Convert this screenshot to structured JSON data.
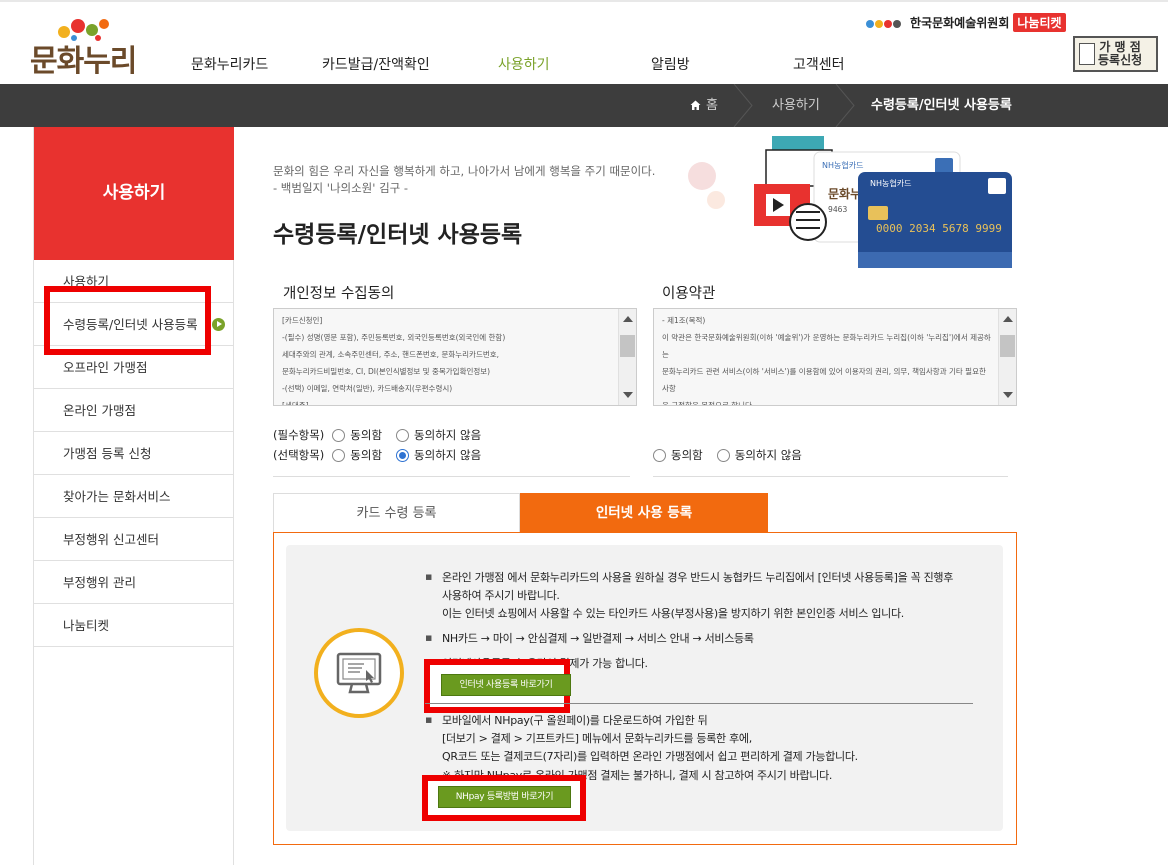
{
  "header": {
    "logo_text": "문화누리",
    "nav": [
      "문화누리카드",
      "카드발급/잔액확인",
      "사용하기",
      "알림방",
      "고객센터"
    ],
    "nav_active_index": 2,
    "org_name": "한국문화예술위원회",
    "ticket_label": "나눔티켓",
    "merchant_button": [
      "가 맹 점",
      "등록신청"
    ]
  },
  "breadcrumb": {
    "home": "홈",
    "level1": "사용하기",
    "current": "수령등록/인터넷 사용등록"
  },
  "sidebar": {
    "title": "사용하기",
    "items": [
      "사용하기",
      "수령등록/인터넷 사용등록",
      "오프라인 가맹점",
      "온라인 가맹점",
      "가맹점 등록 신청",
      "찾아가는 문화서비스",
      "부정행위 신고센터",
      "부정행위 관리",
      "나눔티켓"
    ],
    "active_index": 1
  },
  "main": {
    "quote_line1": "문화의 힘은 우리 자신을 행복하게 하고, 나아가서 남에게 행복을 주기 때문이다.",
    "quote_line2": "- 백범일지 '나의소원' 김구 -",
    "title": "수령등록/인터넷 사용등록",
    "card_illustration": {
      "card_brand": "NH농협카드",
      "card_number": "0000 2034 5678 9999",
      "logo_text": "문화누리"
    }
  },
  "privacy": {
    "title": "개인정보 수집동의",
    "lines": [
      "[카드신청인]",
      "-(필수) 성명(영문 포함), 주민등록번호, 외국인등록번호(외국인에 한함)",
      "세대주와의 관계, 소속주민센터, 주소, 핸드폰번호, 문화누리카드번호,",
      "문화누리카드비밀번호, CI, DI(본인식별정보 및 중복가입확인정보)",
      "-(선택) 이메일, 연락처(일반), 카드배송지(우편수령시)",
      "[세대주]"
    ],
    "required_label": "(필수항목)",
    "optional_label": "(선택항목)",
    "agree": "동의함",
    "disagree": "동의하지 않음"
  },
  "terms": {
    "title": "이용약관",
    "lines": [
      "- 제1조(목적)",
      "이 약관은 한국문화예술위원회(이하 '예술위')가 운영하는 문화누리카드 누리집(이하 '누리집')에서 제공하는",
      "문화누리카드 관련 서비스(이하 '서비스')를 이용함에 있어 이용자의 권리, 의무, 책임사항과 기타 필요한 사항",
      "을 규정함을 목적으로 합니다."
    ],
    "agree": "동의함",
    "disagree": "동의하지 않음"
  },
  "tabs": [
    "카드 수령 등록",
    "인터넷 사용 등록"
  ],
  "internet_section": {
    "para1_line1": "온라인 가맹점 에서 문화누리카드의 사용을 원하실 경우 반드시 농협카드 누리집에서 [인터넷 사용등록]을 꼭 진행후",
    "para1_line2": "사용하여 주시기 바랍니다.",
    "para1_line3": "이는 인터넷 쇼핑에서 사용할 수 있는 타인카드 사용(부정사용)을 방지하기 위한 본인인증 서비스 입니다.",
    "para2": "NH카드 → 마이 → 안심결제 → 일반결제 → 서비스 안내 → 서비스등록",
    "para3": "인터넷사용등록 후 온라인 결제가 가능 합니다.",
    "button1": "인터넷 사용등록 바로가기",
    "para4_line1": "모바일에서 NHpay(구 올원페이)를 다운로드하여 가입한 뒤",
    "para4_line2": "[더보기 > 결제 > 기프트카드] 메뉴에서 문화누리카드를 등록한 후에,",
    "para4_line3": "QR코드 또는 결제코드(7자리)를 입력하면 온라인 가맹점에서 쉽고 편리하게 결제 가능합니다.",
    "para4_line4": "※ 하지만 NHpay로 온라인 가맹점 결제는 불가하니, 결제 시 참고하여 주시기 바랍니다.",
    "button2": "NHpay 등록방법 바로가기"
  },
  "colors": {
    "accent_red": "#e8322f",
    "tab_orange": "#f26a0f",
    "nav_green": "#7aa22a",
    "button_green": "#6a9a1f",
    "highlight_red": "#ee0000",
    "breadcrumb_bg": "#3d3d3d"
  }
}
